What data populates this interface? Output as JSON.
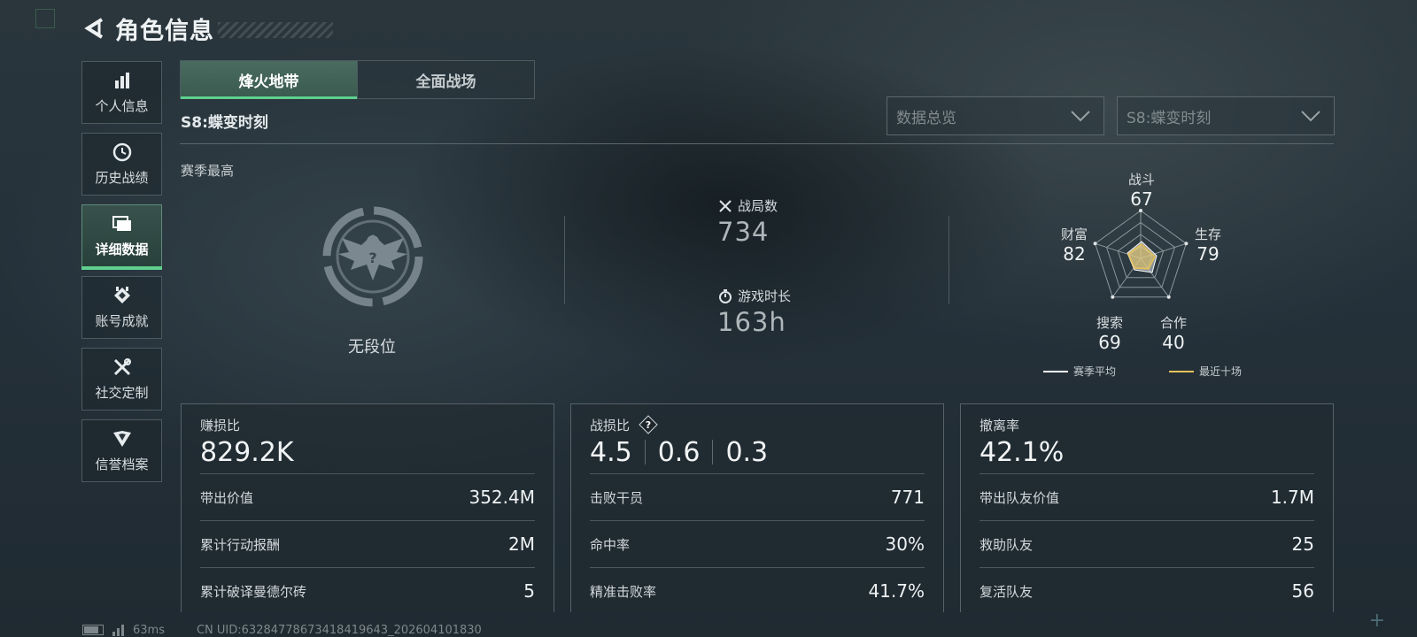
{
  "header": {
    "title": "角色信息"
  },
  "sidebar": {
    "items": [
      {
        "label": "个人信息",
        "icon": "bar-chart-icon",
        "active": false
      },
      {
        "label": "历史战绩",
        "icon": "history-clock-icon",
        "active": false
      },
      {
        "label": "详细数据",
        "icon": "folder-icon",
        "active": true
      },
      {
        "label": "账号成就",
        "icon": "achievement-icon",
        "active": false
      },
      {
        "label": "社交定制",
        "icon": "tools-icon",
        "active": false
      },
      {
        "label": "信誉档案",
        "icon": "shield-emblem-icon",
        "active": false
      }
    ]
  },
  "tabs": [
    {
      "label": "烽火地带",
      "active": true
    },
    {
      "label": "全面战场",
      "active": false
    }
  ],
  "season_label": "S8:蝶变时刻",
  "filters": {
    "view": "数据总览",
    "season": "S8:蝶变时刻"
  },
  "season_best_label": "赛季最高",
  "rank": {
    "name": "无段位"
  },
  "stats": {
    "matches": {
      "label": "战局数",
      "value": "734"
    },
    "playtime": {
      "label": "游戏时长",
      "value": "163h"
    }
  },
  "radar": {
    "axes": [
      {
        "label": "战斗",
        "value": "67"
      },
      {
        "label": "生存",
        "value": "79"
      },
      {
        "label": "合作",
        "value": "40"
      },
      {
        "label": "搜索",
        "value": "69"
      },
      {
        "label": "财富",
        "value": "82"
      }
    ],
    "legend": {
      "season_avg": "赛季平均",
      "recent10": "最近十场"
    },
    "colors": {
      "season_avg": "#ffffff",
      "recent10": "#e8c25a"
    }
  },
  "cards": {
    "profit": {
      "title": "赚损比",
      "big": "829.2K",
      "rows": [
        {
          "label": "带出价值",
          "value": "352.4M"
        },
        {
          "label": "累计行动报酬",
          "value": "2M"
        },
        {
          "label": "累计破译曼德尔砖",
          "value": "5"
        }
      ]
    },
    "combat": {
      "title": "战损比",
      "big": [
        "4.5",
        "0.6",
        "0.3"
      ],
      "rows": [
        {
          "label": "击败干员",
          "value": "771"
        },
        {
          "label": "命中率",
          "value": "30%"
        },
        {
          "label": "精准击败率",
          "value": "41.7%"
        }
      ]
    },
    "extract": {
      "title": "撤离率",
      "big": "42.1%",
      "rows": [
        {
          "label": "带出队友价值",
          "value": "1.7M"
        },
        {
          "label": "救助队友",
          "value": "25"
        },
        {
          "label": "复活队友",
          "value": "56"
        }
      ]
    }
  },
  "status": {
    "ping": "63ms",
    "uid": "CN UID:6328477867341841964​3_202604101830"
  }
}
